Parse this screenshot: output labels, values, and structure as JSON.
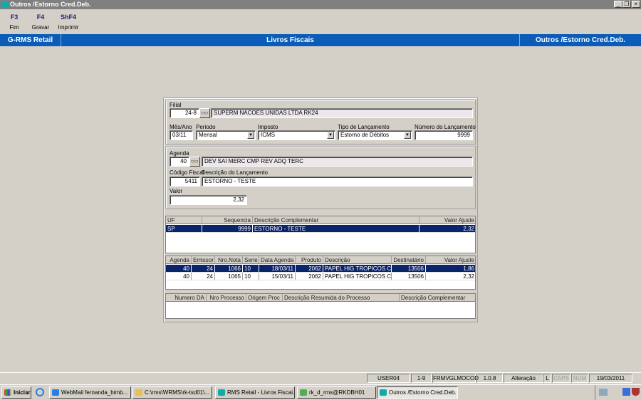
{
  "window": {
    "title": "Outros /Estorno Cred.Deb.",
    "controls": [
      "_",
      "❐",
      "×"
    ]
  },
  "toolbar": [
    {
      "key": "F3",
      "label": "Fim"
    },
    {
      "key": "F4",
      "label": "Gravar"
    },
    {
      "key": "ShF4",
      "label": "Imprimir"
    }
  ],
  "header": {
    "app": "G-RMS Retail",
    "module": "Livros Fiscais",
    "screen": "Outros /Estorno Cred.Deb."
  },
  "form": {
    "filial": {
      "label": "Filial",
      "code": "24-8",
      "name": "SUPERM NACOES UNIDAS LTDA RK24"
    },
    "mes_ano": {
      "label": "Mês/Ano",
      "value": "03/11"
    },
    "periodo": {
      "label": "Periodo",
      "value": "Mensal"
    },
    "imposto": {
      "label": "Imposto",
      "value": "ICMS"
    },
    "tipo": {
      "label": "Tipo de Lançamento",
      "value": "Estorno de Débitos"
    },
    "numero": {
      "label": "Número do Lançamento",
      "value": "9999"
    },
    "agenda": {
      "label": "Agenda",
      "code": "40",
      "name": "DEV SAI MERC CMP REV ADQ TERC"
    },
    "codigo_fiscal": {
      "label": "Código Fiscal",
      "value": "5411"
    },
    "descricao": {
      "label": "Descrição do Lançamento",
      "value": "ESTORNO - TESTE"
    },
    "valor": {
      "label": "Valor",
      "value": "2,32"
    }
  },
  "grid1": {
    "columns": [
      "UF",
      "Sequencia",
      "Descrição Complementar",
      "Valor Ajuste"
    ],
    "rows": [
      [
        "SP",
        "9999",
        "ESTORNO - TESTE",
        "2,32"
      ]
    ]
  },
  "grid2": {
    "columns": [
      "Agenda",
      "Emissor",
      "Nro.Nota",
      "Serie",
      "Data Agenda",
      "Produto",
      "Descrição",
      "Destinatário",
      "Valor Ajuste"
    ],
    "rows": [
      [
        "40",
        "24",
        "1066",
        "10",
        "18/03/11",
        "2062",
        "PAPEL HIG TROPICOS C/",
        "13506",
        "1,86"
      ],
      [
        "40",
        "24",
        "1065",
        "10",
        "15/03/11",
        "2062",
        "PAPEL HIG TROPICOS C/",
        "13506",
        "2,32"
      ]
    ]
  },
  "grid3": {
    "columns": [
      "Numero DA",
      "Nro Processo",
      "Origem Proc",
      "Descrição Resumida do Processo",
      "Descrição Complementar"
    ],
    "rows": []
  },
  "status": [
    "USER04",
    "1-9",
    "FRMVGLMOCOD",
    "1.0.8",
    "Alteração",
    "L",
    "CAPS",
    "NUM",
    "19/03/2011"
  ],
  "taskbar": {
    "start": "Iniciar",
    "items": [
      "WebMail fernanda_bimb...",
      "C:\\rms\\WRMS\\rk-tsd01\\...",
      "RMS Retail - Livros Fiscai...",
      "rk_d_rms@RKDBH01",
      "Outros /Estorno Cred.Deb."
    ]
  }
}
